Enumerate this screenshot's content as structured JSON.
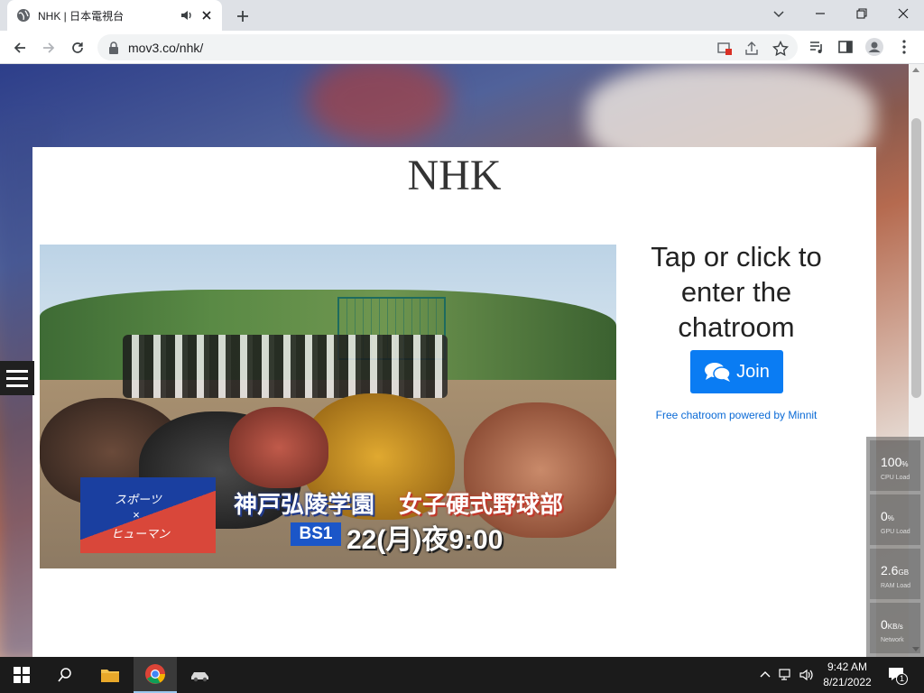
{
  "browser": {
    "tab_title": "NHK | 日本電視台",
    "url": "mov3.co/nhk/"
  },
  "page": {
    "site_title": "NHK",
    "chat_prompt": "Tap or click to enter the chatroom",
    "join_label": "Join",
    "powered_by": "Free chatroom powered by Minnit",
    "accent_color": "#0a7cf3"
  },
  "video": {
    "banner_line1": "スポーツ",
    "banner_line2": "×",
    "banner_line3": "ヒューマン",
    "caption_school": "神戸弘陵学園",
    "caption_club": "女子硬式野球部",
    "channel": "BS1",
    "airtime": "22(月)夜9:00"
  },
  "perf_widget": [
    {
      "value": "100",
      "unit": "%",
      "label": "CPU Load"
    },
    {
      "value": "0",
      "unit": "%",
      "label": "GPU Load"
    },
    {
      "value": "2.6",
      "unit": "GB",
      "label": "RAM Load"
    },
    {
      "value": "0",
      "unit": "KB/s",
      "label": "Network"
    }
  ],
  "taskbar": {
    "time": "9:42 AM",
    "date": "8/21/2022",
    "notification_count": "1"
  }
}
